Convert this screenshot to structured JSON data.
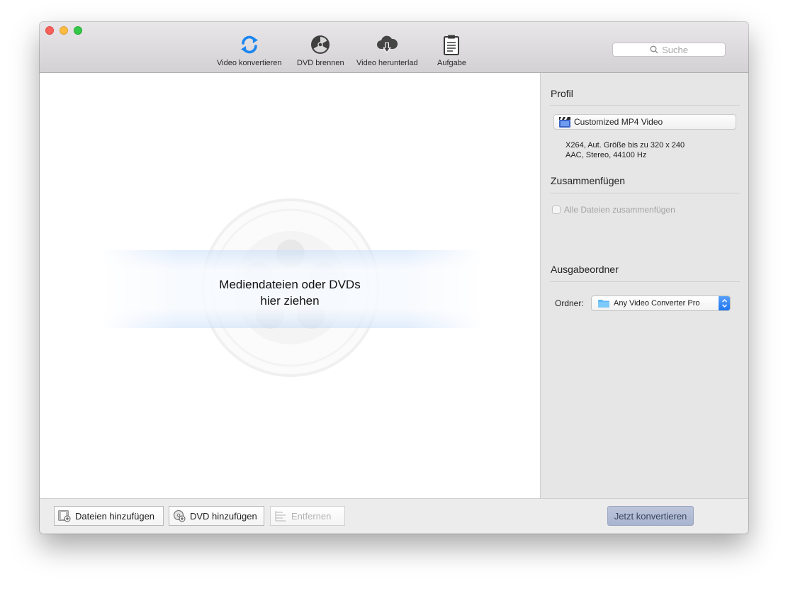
{
  "toolbar": {
    "items": [
      {
        "label": "Video konvertieren",
        "icon": "convert-icon"
      },
      {
        "label": "DVD brennen",
        "icon": "burn-dvd-icon"
      },
      {
        "label": "Video herunterlad",
        "icon": "cloud-download-icon"
      },
      {
        "label": "Aufgabe",
        "icon": "clipboard-icon"
      }
    ],
    "search_placeholder": "Suche"
  },
  "dropzone": {
    "line1": "Mediendateien oder DVDs",
    "line2": "hier ziehen"
  },
  "sidebar": {
    "profile": {
      "title": "Profil",
      "selected": "Customized MP4 Video",
      "info_line1": "X264, Aut. Größe bis zu 320 x 240",
      "info_line2": "AAC, Stereo, 44100 Hz"
    },
    "merge": {
      "title": "Zusammenfügen",
      "checkbox_label": "Alle Dateien zusammenfügen",
      "checked": false
    },
    "output": {
      "title": "Ausgabeordner",
      "folder_label": "Ordner:",
      "folder_value": "Any Video Converter Pro"
    }
  },
  "bottom": {
    "add_files": "Dateien hinzufügen",
    "add_dvd": "DVD hinzufügen",
    "remove": "Entfernen",
    "convert": "Jetzt konvertieren"
  },
  "colors": {
    "accent": "#1b72f0",
    "convert_button": "#b3bdd6"
  }
}
